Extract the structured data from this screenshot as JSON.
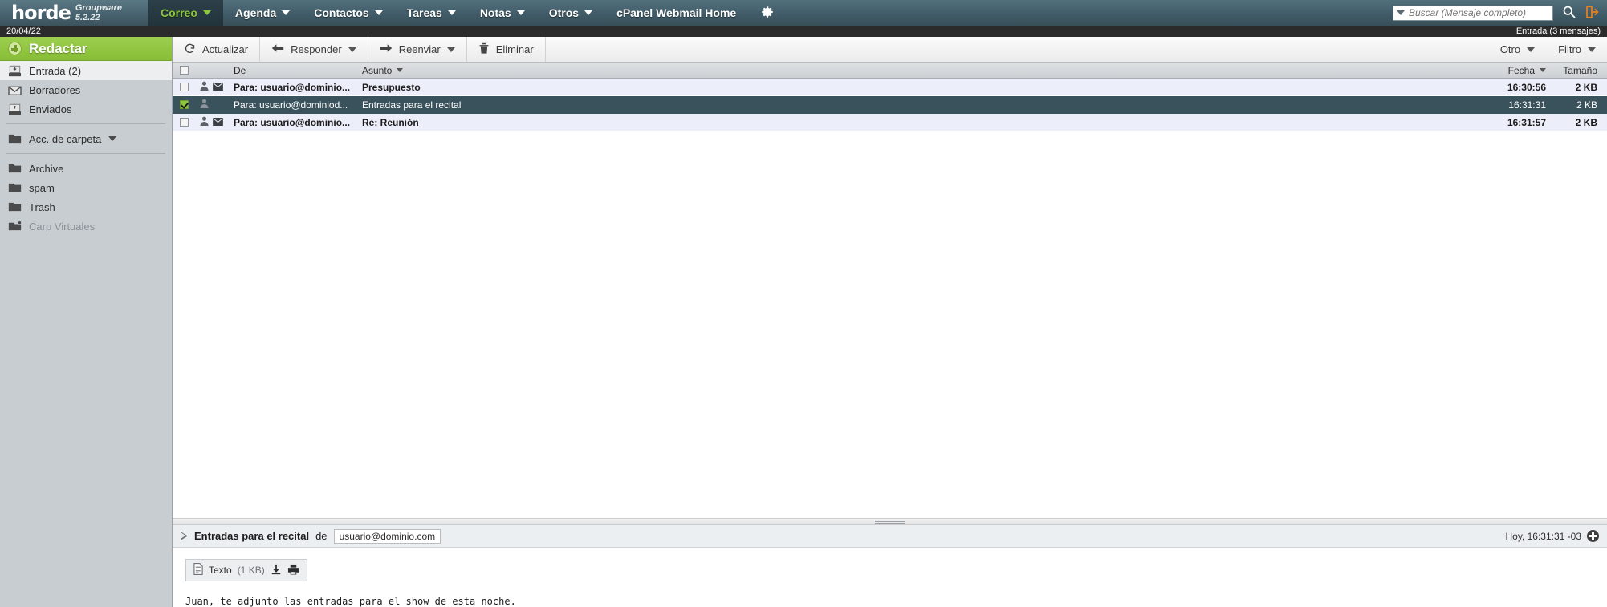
{
  "brand": {
    "name": "horde",
    "product": "Groupware 5.2.22"
  },
  "nav": {
    "items": [
      {
        "label": "Correo",
        "caret": true,
        "active": true,
        "name": "nav-correo"
      },
      {
        "label": "Agenda",
        "caret": true,
        "active": false,
        "name": "nav-agenda"
      },
      {
        "label": "Contactos",
        "caret": true,
        "active": false,
        "name": "nav-contactos"
      },
      {
        "label": "Tareas",
        "caret": true,
        "active": false,
        "name": "nav-tareas"
      },
      {
        "label": "Notas",
        "caret": true,
        "active": false,
        "name": "nav-notas"
      },
      {
        "label": "Otros",
        "caret": true,
        "active": false,
        "name": "nav-otros"
      },
      {
        "label": "cPanel Webmail Home",
        "caret": false,
        "active": false,
        "name": "nav-cpanel-webmail-home"
      }
    ],
    "gear_icon": "gear-icon",
    "logout_icon": "logout-icon"
  },
  "search": {
    "placeholder": "Buscar (Mensaje completo)",
    "value": "",
    "icon": "search-icon",
    "scope_caret": "chevron-down-icon"
  },
  "statusbar": {
    "date": "20/04/22",
    "mailbox": "Entrada (3 mensajes)"
  },
  "sidebar": {
    "compose": {
      "label": "Redactar",
      "icon": "plus-circle-icon"
    },
    "mailboxes": [
      {
        "label": "Entrada (2)",
        "icon": "inbox-icon",
        "selected": true,
        "dim": false
      },
      {
        "label": "Borradores",
        "icon": "drafts-icon",
        "selected": false,
        "dim": false
      },
      {
        "label": "Enviados",
        "icon": "sent-icon",
        "selected": false,
        "dim": false
      }
    ],
    "actions": {
      "label": "Acc. de carpeta",
      "icon": "folder-icon",
      "caret": true
    },
    "folders": [
      {
        "label": "Archive",
        "icon": "folder-icon",
        "dim": false
      },
      {
        "label": "spam",
        "icon": "folder-icon",
        "dim": false
      },
      {
        "label": "Trash",
        "icon": "folder-icon",
        "dim": false
      },
      {
        "label": "Carp Virtuales",
        "icon": "folder-virtual-icon",
        "dim": true
      }
    ]
  },
  "toolbar": {
    "left": [
      {
        "label": "Actualizar",
        "icon": "refresh-icon",
        "caret": false,
        "name": "refresh-button"
      },
      {
        "label": "Responder",
        "icon": "arrow-left-icon",
        "caret": true,
        "name": "reply-button"
      },
      {
        "label": "Reenviar",
        "icon": "arrow-right-icon",
        "caret": true,
        "name": "forward-button"
      },
      {
        "label": "Eliminar",
        "icon": "trash-icon",
        "caret": false,
        "name": "delete-button"
      }
    ],
    "right": [
      {
        "label": "Otro",
        "caret": true,
        "name": "other-menu"
      },
      {
        "label": "Filtro",
        "caret": true,
        "name": "filter-menu"
      }
    ]
  },
  "list": {
    "columns": {
      "from": "De",
      "subject": "Asunto",
      "date": "Fecha",
      "size": "Tamaño"
    },
    "sorted_column": "subject",
    "header_checkbox": false,
    "rows": [
      {
        "checked": false,
        "unread": true,
        "selected": false,
        "from": "Para: usuario@dominio...",
        "subject": "Presupuesto",
        "date": "16:30:56",
        "size": "2 KB",
        "person_icon": "person-icon",
        "status_icon": "envelope-icon"
      },
      {
        "checked": true,
        "unread": false,
        "selected": true,
        "from": "Para: usuario@dominiod...",
        "subject": "Entradas para el recital",
        "date": "16:31:31",
        "size": "2 KB",
        "person_icon": "person-icon",
        "status_icon": ""
      },
      {
        "checked": false,
        "unread": true,
        "selected": false,
        "from": "Para: usuario@dominio...",
        "subject": "Re: Reunión",
        "date": "16:31:57",
        "size": "2 KB",
        "person_icon": "person-icon",
        "status_icon": "envelope-icon"
      }
    ]
  },
  "preview": {
    "toggle_icon": "triangle-right-icon",
    "subject": "Entradas para el recital",
    "from_label": "de",
    "from_address": "usuario@dominio.com",
    "timestamp": "Hoy, 16:31:31 -03",
    "expand_icon": "plus-circle-dark-icon",
    "attachment": {
      "icon": "document-icon",
      "name": "Texto",
      "size": "(1 KB)",
      "download_icon": "download-icon",
      "print_icon": "print-icon"
    },
    "body": "Juan, te adjunto las entradas para el show de esta noche."
  },
  "colors": {
    "accent_green": "#8cc63e",
    "nav_bg": "#3f5a66",
    "selected_row": "#3a525c",
    "row_bg": "#eceefa",
    "sidebar_bg": "#c7cdd1",
    "logout_orange": "#e8821e"
  }
}
